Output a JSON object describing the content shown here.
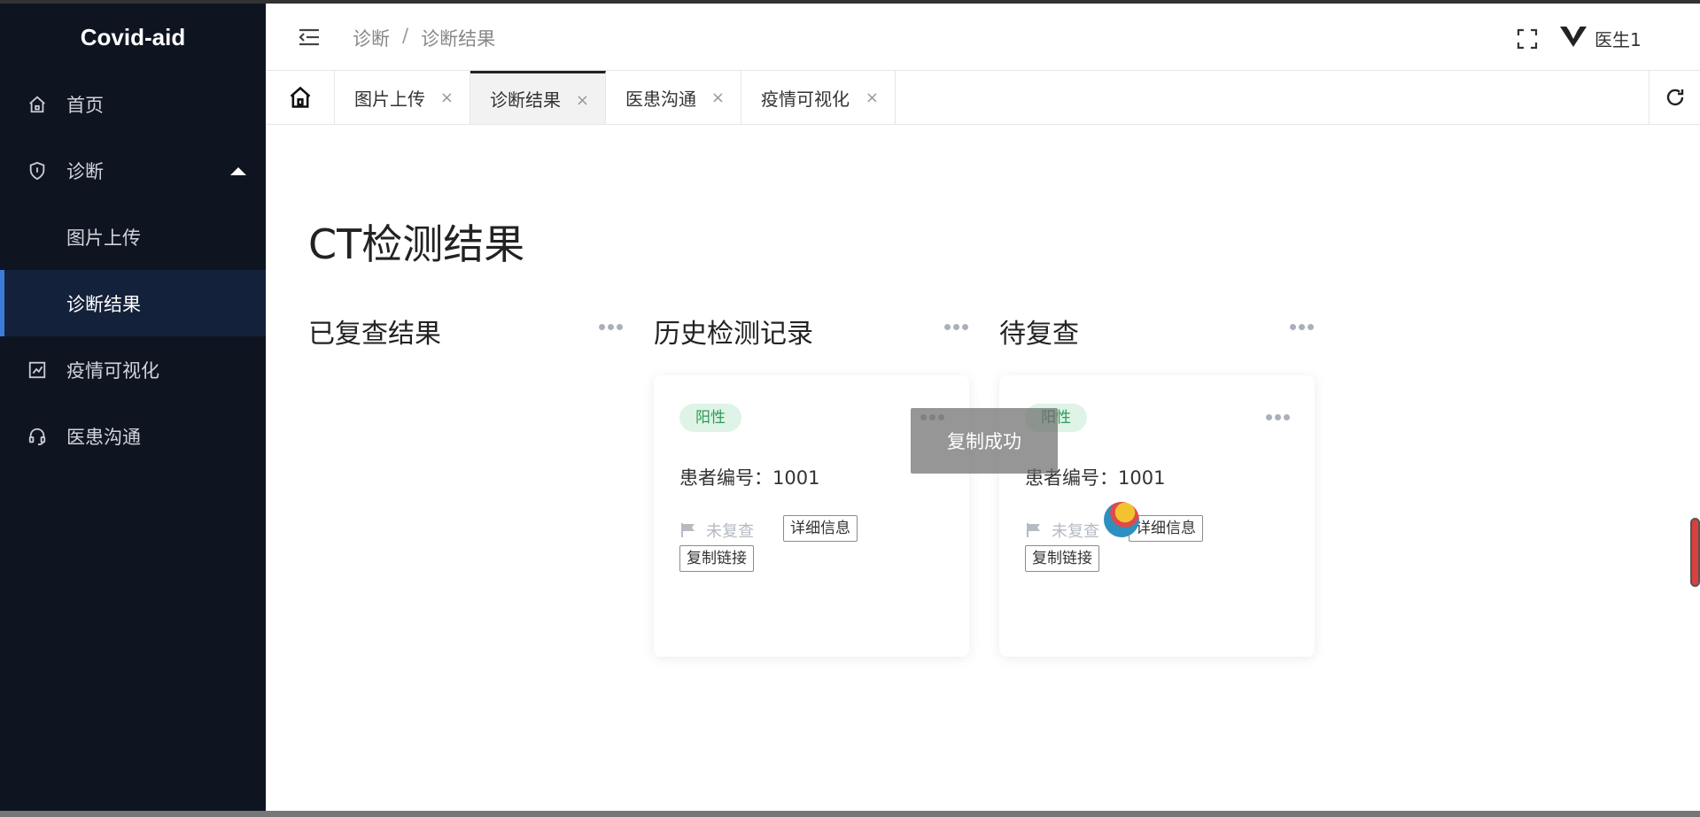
{
  "app": {
    "logo": "Covid-aid"
  },
  "sidebar": {
    "items": [
      {
        "label": "首页",
        "icon": "home-icon"
      },
      {
        "label": "诊断",
        "icon": "shield-icon",
        "expanded": true
      },
      {
        "label": "图片上传",
        "sub": true
      },
      {
        "label": "诊断结果",
        "sub": true,
        "active": true
      },
      {
        "label": "疫情可视化",
        "icon": "chart-icon"
      },
      {
        "label": "医患沟通",
        "icon": "headset-icon"
      }
    ]
  },
  "header": {
    "breadcrumb": [
      "诊断",
      "诊断结果"
    ],
    "breadcrumb_sep": "/",
    "user": "医生1"
  },
  "tabs": [
    {
      "label": "图片上传",
      "close": "×"
    },
    {
      "label": "诊断结果",
      "close": "×",
      "active": true
    },
    {
      "label": "医患沟通",
      "close": "×"
    },
    {
      "label": "疫情可视化",
      "close": "×"
    }
  ],
  "main": {
    "title": "CT检测结果",
    "columns": [
      {
        "title": "已复查结果"
      },
      {
        "title": "历史检测记录"
      },
      {
        "title": "待复查"
      }
    ],
    "cards": [
      {
        "tag": "阳性",
        "patient": "患者编号：1001",
        "status": "未复查",
        "detail_btn": "详细信息",
        "copy_btn": "复制链接"
      },
      {
        "tag": "阳性",
        "patient": "患者编号：1001",
        "status": "未复查",
        "detail_btn": "详细信息",
        "copy_btn": "复制链接"
      }
    ],
    "toast": "复制成功"
  },
  "colors": {
    "sidebar_bg": "#0e1521",
    "active_accent": "#3d7bd9",
    "tag_bg": "#dff3e7",
    "tag_text": "#2e9a58"
  }
}
